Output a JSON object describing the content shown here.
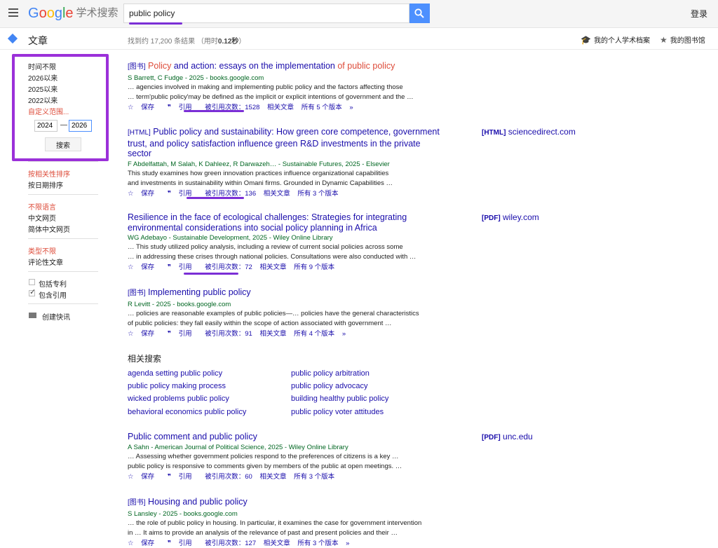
{
  "header": {
    "logo_google": "Google",
    "logo_sub": "学术搜索",
    "search_value": "public policy",
    "login": "登录"
  },
  "subheader": {
    "articles": "文章",
    "stats_prefix": "找到约 17,200 条结果 （用时",
    "stats_time": "0.12秒",
    "stats_suffix": "）",
    "profile": "我的个人学术档案",
    "library": "我的图书馆"
  },
  "sidebar": {
    "time_any": "时间不限",
    "since_2026": "2026以来",
    "since_2025": "2025以来",
    "since_2022": "2022以来",
    "custom_range": "自定义范围...",
    "year_from": "2024",
    "year_to": "2026",
    "dash": "—",
    "search_btn": "搜索",
    "sort_relevance": "按相关性排序",
    "sort_date": "按日期排序",
    "lang_any": "不限语言",
    "lang_chinese_web": "中文网页",
    "lang_simplified": "简体中文网页",
    "type_any": "类型不限",
    "type_review": "评论性文章",
    "include_patents": "包括专利",
    "include_citations": "包含引用",
    "create_alert": "创建快讯"
  },
  "results": [
    {
      "tag": "[图书]",
      "title_parts": [
        "Policy",
        " and action: essays on the implementation ",
        "of",
        " ",
        "public policy"
      ],
      "meta": "S Barrett, C Fudge - 2025 - books.google.com",
      "snippet1": "… agencies involved in making and implementing public policy and the factors affecting those",
      "snippet2": "… term'public policy'may be defined as the implicit or explicit intentions of government and the …",
      "save": "保存",
      "cite": "引用",
      "cited_by": "被引用次数：1528",
      "related": "相关文章",
      "versions": "所有 5 个版本"
    },
    {
      "tag": "[HTML]",
      "title": "Public policy and sustainability: How green core competence, government trust, and policy satisfaction influence green R&D investments in the private sector",
      "meta": "F Abdelfattah, M Salah, K Dahleez, R Darwazeh… - Sustainable Futures, 2025 - Elsevier",
      "snippet1": "This study examines how green innovation practices influence organizational capabilities",
      "snippet2": "and investments in sustainability within Omani firms. Grounded in Dynamic Capabilities …",
      "save": "保存",
      "cite": "引用",
      "cited_by": "被引用次数：136",
      "related": "相关文章",
      "versions": "所有 3 个版本",
      "side_tag": "[HTML]",
      "side_site": "sciencedirect.com"
    },
    {
      "title": "Resilience in the face of ecological challenges: Strategies for integrating environmental considerations into social policy planning in Africa",
      "meta": "WG Adebayo - Sustainable Development, 2025 - Wiley Online Library",
      "snippet1": "… This study utilized policy analysis, including a review of current social policies across some",
      "snippet2": "… in addressing these crises through national policies. Consultations were also conducted with …",
      "save": "保存",
      "cite": "引用",
      "cited_by": "被引用次数：72",
      "related": "相关文章",
      "versions": "所有 9 个版本",
      "side_tag": "[PDF]",
      "side_site": "wiley.com"
    },
    {
      "tag": "[图书]",
      "title": "Implementing public policy",
      "meta": "R Levitt - 2025 - books.google.com",
      "snippet1": "… policies are reasonable examples of public policies—… policies have the general characteristics",
      "snippet2": "of public policies: they fall easily within the scope of action associated with government …",
      "save": "保存",
      "cite": "引用",
      "cited_by": "被引用次数：91",
      "related": "相关文章",
      "versions": "所有 4 个版本"
    },
    {
      "title": "Public comment and public policy",
      "meta": "A Sahn - American Journal of Political Science, 2025 - Wiley Online Library",
      "snippet1": "… Assessing whether government policies respond to the preferences of citizens is a key …",
      "snippet2": "public policy is responsive to comments given by members of the public at open meetings. …",
      "save": "保存",
      "cite": "引用",
      "cited_by": "被引用次数：60",
      "related": "相关文章",
      "versions": "所有 3 个版本",
      "side_tag": "[PDF]",
      "side_site": "unc.edu"
    },
    {
      "tag": "[图书]",
      "title": "Housing and public policy",
      "meta": "S Lansley - 2025 - books.google.com",
      "snippet1": "… the role of public policy in housing. In particular, it examines the case for government intervention",
      "snippet2": "in … It aims to provide an analysis of the relevance of past and present policies and their …",
      "save": "保存",
      "cite": "引用",
      "cited_by": "被引用次数：127",
      "related": "相关文章",
      "versions": "所有 3 个版本"
    }
  ],
  "related_searches": {
    "title": "相关搜索",
    "items": [
      "agenda setting public policy",
      "public policy arbitration",
      "public policy making process",
      "public policy advocacy",
      "wicked problems public policy",
      "building healthy public policy",
      "behavioral economics public policy",
      "public policy voter attitudes"
    ]
  },
  "colors": {
    "accent": "#4d90fe",
    "link": "#1a0dab",
    "highlight": "#dd4b39",
    "meta": "#006621",
    "annotation": "#9b30d9"
  }
}
